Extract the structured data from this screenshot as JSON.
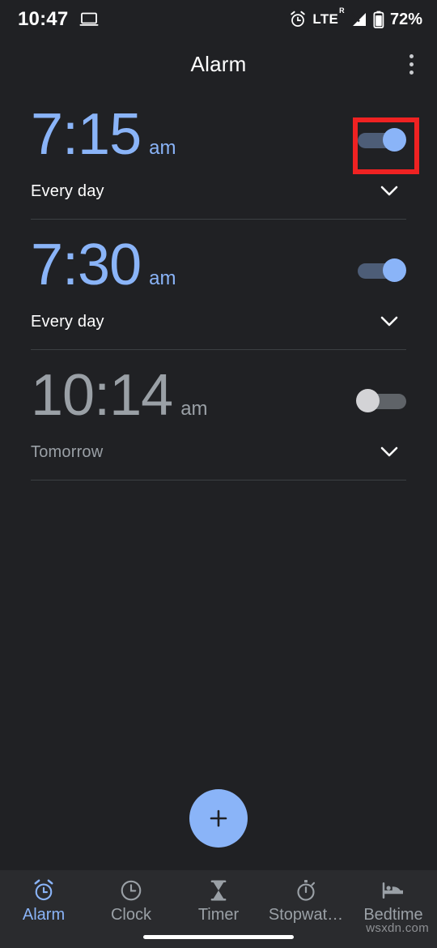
{
  "status_bar": {
    "time": "10:47",
    "cast_icon": "laptop-icon",
    "alarm_icon": "alarm-clock-icon",
    "network_type": "LTE",
    "roaming_indicator": "R",
    "signal_icon": "signal-bars-icon",
    "battery_icon": "battery-icon",
    "battery_percent": "72%"
  },
  "app_bar": {
    "title": "Alarm",
    "overflow_menu": "more-options"
  },
  "alarms": [
    {
      "time": "7:15",
      "meridiem": "am",
      "repeat": "Every day",
      "enabled": true,
      "highlighted": true
    },
    {
      "time": "7:30",
      "meridiem": "am",
      "repeat": "Every day",
      "enabled": true,
      "highlighted": false
    },
    {
      "time": "10:14",
      "meridiem": "am",
      "repeat": "Tomorrow",
      "enabled": false,
      "highlighted": false
    }
  ],
  "fab": {
    "label": "+",
    "icon": "plus-icon"
  },
  "bottom_nav": {
    "items": [
      {
        "label": "Alarm",
        "icon": "alarm-clock-icon",
        "active": true
      },
      {
        "label": "Clock",
        "icon": "clock-icon",
        "active": false
      },
      {
        "label": "Timer",
        "icon": "hourglass-icon",
        "active": false
      },
      {
        "label": "Stopwat…",
        "icon": "stopwatch-icon",
        "active": false
      },
      {
        "label": "Bedtime",
        "icon": "bed-icon",
        "active": false
      }
    ]
  },
  "annotation": {
    "type": "highlight-box",
    "color": "#ef2222",
    "target": "alarm-toggle-0"
  },
  "watermark": "wsxdn.com",
  "colors": {
    "background": "#202124",
    "accent": "#8ab4f8",
    "nav_background": "#2a2b2e",
    "disabled_text": "#9aa0a6",
    "divider": "#3c4043"
  }
}
